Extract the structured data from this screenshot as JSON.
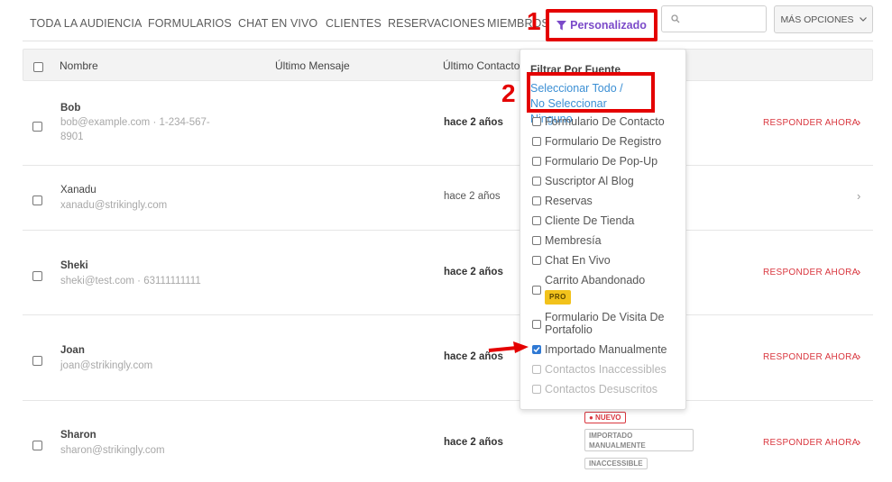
{
  "nav": {
    "tabs": [
      "TODA LA AUDIENCIA",
      "FORMULARIOS",
      "CHAT EN VIVO",
      "CLIENTES",
      "RESERVACIONES",
      "MIEMBROS"
    ],
    "filter_label": "Personalizado",
    "search_placeholder": "",
    "more_label": "MÁS OPCIONES"
  },
  "table": {
    "headers": {
      "name": "Nombre",
      "last_message": "Último Mensaje",
      "last_contact": "Último Contacto"
    },
    "rows": [
      {
        "name": "Bob",
        "sub": "bob@example.com · 1-234-567-8901",
        "date": "hace 2 años",
        "action": "RESPONDER AHORA",
        "unread": true
      },
      {
        "name": "Xanadu",
        "sub": "xanadu@strikingly.com",
        "date": "hace 2 años",
        "action": "",
        "unread": false
      },
      {
        "name": "Sheki",
        "sub": "sheki@test.com · 63111111111",
        "date": "hace 2 años",
        "action": "RESPONDER AHORA",
        "unread": true
      },
      {
        "name": "Joan",
        "sub": "joan@strikingly.com",
        "date": "hace 2 años",
        "action": "RESPONDER AHORA",
        "unread": true
      },
      {
        "name": "Sharon",
        "sub": "sharon@strikingly.com",
        "date": "hace 2 años",
        "action": "RESPONDER AHORA",
        "unread": true
      }
    ],
    "sharon_tags": {
      "new": "● NUEVO",
      "imported": "IMPORTADO MANUALMENTE",
      "inaccessible": "INACCESSIBLE"
    }
  },
  "dropdown": {
    "title": "Filtrar Por Fuente",
    "select_all": "Seleccionar Todo",
    "separator": " / ",
    "select_none": "No Seleccionar Ninguno",
    "items": [
      {
        "label": "Formulario De Contacto",
        "checked": false,
        "disabled": false
      },
      {
        "label": "Formulario De Registro",
        "checked": false,
        "disabled": false
      },
      {
        "label": "Formulario De Pop-Up",
        "checked": false,
        "disabled": false
      },
      {
        "label": "Suscriptor Al Blog",
        "checked": false,
        "disabled": false
      },
      {
        "label": "Reservas",
        "checked": false,
        "disabled": false
      },
      {
        "label": "Cliente De Tienda",
        "checked": false,
        "disabled": false
      },
      {
        "label": "Membresía",
        "checked": false,
        "disabled": false
      },
      {
        "label": "Chat En Vivo",
        "checked": false,
        "disabled": false
      },
      {
        "label": "Carrito Abandonado",
        "checked": false,
        "disabled": false,
        "badge": "PRO"
      },
      {
        "label": "Formulario De Visita De Portafolio",
        "checked": false,
        "disabled": false
      },
      {
        "label": "Importado Manualmente",
        "checked": true,
        "disabled": false
      },
      {
        "label": "Contactos Inaccessibles",
        "checked": false,
        "disabled": true
      },
      {
        "label": "Contactos Desuscritos",
        "checked": false,
        "disabled": true
      }
    ]
  },
  "annotations": {
    "step1": "1",
    "step2": "2"
  },
  "colors": {
    "accent_purple": "#7b4ac9",
    "reply_red": "#d9363e",
    "highlight_red": "#e40000",
    "link_blue": "#3b8fd4"
  },
  "icons": {
    "filter": "filter-icon",
    "search": "search-icon",
    "more": "chevron-down-icon",
    "row_action": "chevron-right-icon",
    "pointer": "arrow-annotation"
  }
}
